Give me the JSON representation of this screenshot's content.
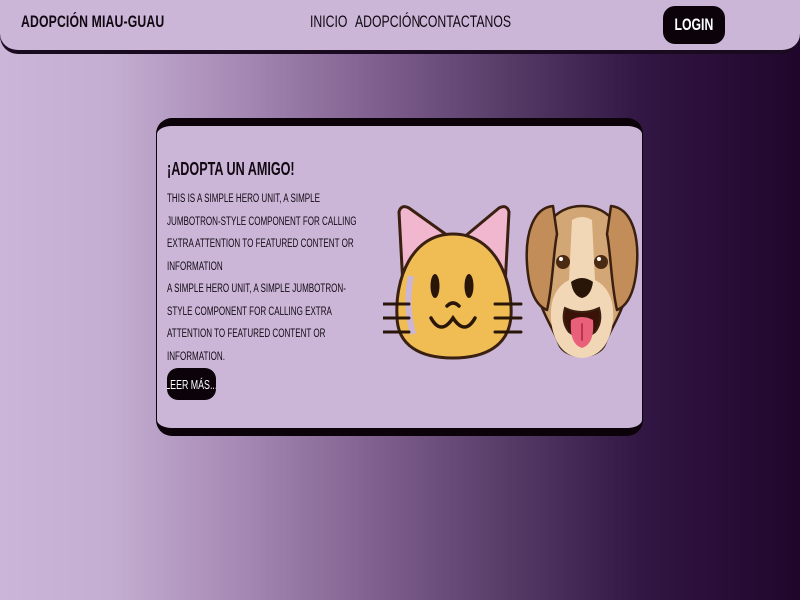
{
  "navbar": {
    "brand": "ADOPCIÓN MIAU-GUAU",
    "links": [
      "INICIO",
      "ADOPCIÓN",
      "CONTACTANOS"
    ],
    "login": "LOGIN"
  },
  "hero": {
    "title": "¡ADOPTA UN AMIGO!",
    "paragraphs": [
      "THIS IS A SIMPLE HERO UNIT, A SIMPLE JUMBOTRON-STYLE COMPONENT FOR CALLING EXTRA ATTENTION TO FEATURED CONTENT OR INFORMATION",
      "A SIMPLE HERO UNIT, A SIMPLE JUMBOTRON-STYLE COMPONENT FOR CALLING EXTRA ATTENTION TO FEATURED CONTENT OR INFORMATION."
    ],
    "button": "LEER MÁS..."
  },
  "images": {
    "cat": "cat-face-illustration",
    "dog": "dog-face-illustration"
  },
  "colors": {
    "lavender": "#cbb6d8",
    "dark": "#0b0309",
    "gradient_end": "#20062b",
    "cat_fill": "#f0bd55",
    "dog_fill": "#d3a676"
  }
}
